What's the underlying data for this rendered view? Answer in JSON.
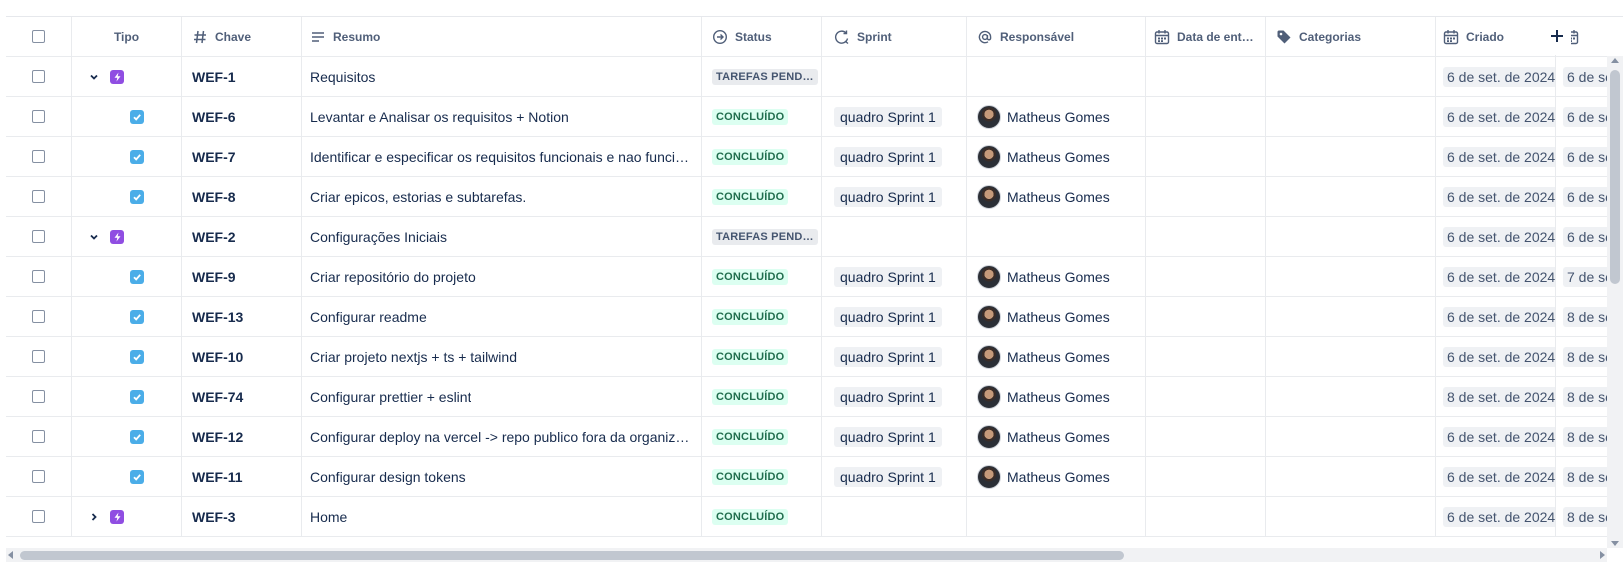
{
  "columns": {
    "tipo": "Tipo",
    "chave": "Chave",
    "resumo": "Resumo",
    "status": "Status",
    "sprint": "Sprint",
    "responsavel": "Responsável",
    "data_entrega": "Data de ent…",
    "categorias": "Categorias",
    "criado": "Criado"
  },
  "rows": [
    {
      "kind": "epic",
      "expanded": true,
      "key": "WEF-1",
      "summary": "Requisitos",
      "status": "TAREFAS PENDE…",
      "status_type": "todo",
      "sprint": "",
      "assignee": "",
      "created": "6 de set. de 2024",
      "last": "6 de se"
    },
    {
      "kind": "task",
      "key": "WEF-6",
      "summary": "Levantar e Analisar os requisitos + Notion",
      "status": "CONCLUÍDO",
      "status_type": "done",
      "sprint": "quadro Sprint 1",
      "assignee": "Matheus Gomes",
      "created": "6 de set. de 2024",
      "last": "6 de se"
    },
    {
      "kind": "task",
      "key": "WEF-7",
      "summary": "Identificar e especificar os requisitos funcionais e nao funci…",
      "status": "CONCLUÍDO",
      "status_type": "done",
      "sprint": "quadro Sprint 1",
      "assignee": "Matheus Gomes",
      "created": "6 de set. de 2024",
      "last": "6 de se"
    },
    {
      "kind": "task",
      "key": "WEF-8",
      "summary": "Criar epicos, estorias e subtarefas.",
      "status": "CONCLUÍDO",
      "status_type": "done",
      "sprint": "quadro Sprint 1",
      "assignee": "Matheus Gomes",
      "created": "6 de set. de 2024",
      "last": "6 de se"
    },
    {
      "kind": "epic",
      "expanded": true,
      "key": "WEF-2",
      "summary": "Configurações Iniciais",
      "status": "TAREFAS PENDE…",
      "status_type": "todo",
      "sprint": "",
      "assignee": "",
      "created": "6 de set. de 2024",
      "last": "6 de se"
    },
    {
      "kind": "task",
      "key": "WEF-9",
      "summary": "Criar repositório do projeto",
      "status": "CONCLUÍDO",
      "status_type": "done",
      "sprint": "quadro Sprint 1",
      "assignee": "Matheus Gomes",
      "created": "6 de set. de 2024",
      "last": "7 de se"
    },
    {
      "kind": "task",
      "key": "WEF-13",
      "summary": "Configurar readme",
      "status": "CONCLUÍDO",
      "status_type": "done",
      "sprint": "quadro Sprint 1",
      "assignee": "Matheus Gomes",
      "created": "6 de set. de 2024",
      "last": "8 de se"
    },
    {
      "kind": "task",
      "key": "WEF-10",
      "summary": "Criar projeto nextjs + ts + tailwind",
      "status": "CONCLUÍDO",
      "status_type": "done",
      "sprint": "quadro Sprint 1",
      "assignee": "Matheus Gomes",
      "created": "6 de set. de 2024",
      "last": "8 de se"
    },
    {
      "kind": "task",
      "key": "WEF-74",
      "summary": "Configurar prettier + eslint",
      "status": "CONCLUÍDO",
      "status_type": "done",
      "sprint": "quadro Sprint 1",
      "assignee": "Matheus Gomes",
      "created": "8 de set. de 2024",
      "last": "8 de se"
    },
    {
      "kind": "task",
      "key": "WEF-12",
      "summary": "Configurar deploy na vercel -> repo publico fora da organiz…",
      "status": "CONCLUÍDO",
      "status_type": "done",
      "sprint": "quadro Sprint 1",
      "assignee": "Matheus Gomes",
      "created": "6 de set. de 2024",
      "last": "8 de se"
    },
    {
      "kind": "task",
      "key": "WEF-11",
      "summary": "Configurar design tokens",
      "status": "CONCLUÍDO",
      "status_type": "done",
      "sprint": "quadro Sprint 1",
      "assignee": "Matheus Gomes",
      "created": "6 de set. de 2024",
      "last": "8 de se"
    },
    {
      "kind": "epic",
      "expanded": false,
      "key": "WEF-3",
      "summary": "Home",
      "status": "CONCLUÍDO",
      "status_type": "done",
      "sprint": "",
      "assignee": "",
      "created": "6 de set. de 2024",
      "last": "8 de se"
    }
  ],
  "colors": {
    "epic": "#904ee2",
    "task": "#4bade8",
    "done_bg": "#dcfff1",
    "done_fg": "#216e4e",
    "todo_bg": "#e9ebee",
    "todo_fg": "#44546f"
  },
  "icons": {
    "tipo": "none",
    "chave": "hash-icon",
    "resumo": "text-lines-icon",
    "status": "status-arrow-icon",
    "sprint": "sprint-cycle-icon",
    "responsavel": "at-sign-icon",
    "data_entrega": "calendar-icon",
    "categorias": "tag-icon",
    "criado": "calendar-icon",
    "add_column": "plus-icon"
  }
}
